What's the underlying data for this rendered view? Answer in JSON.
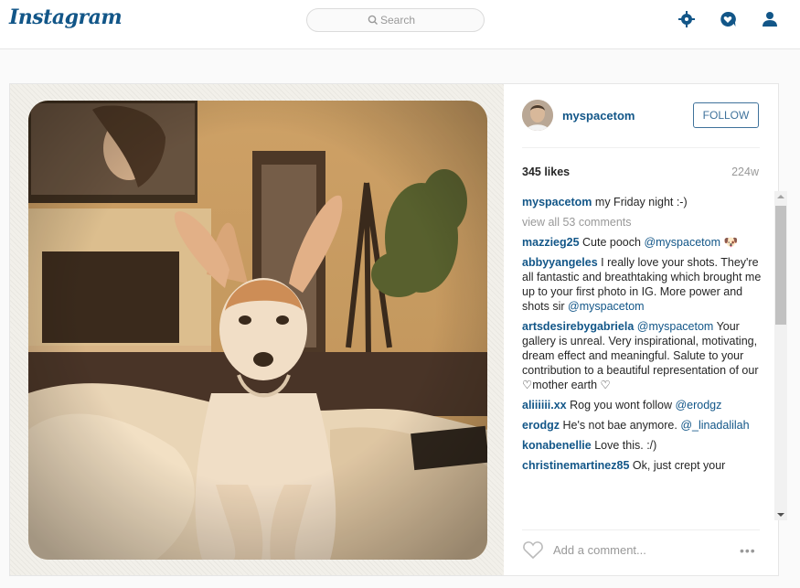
{
  "header": {
    "logo": "Instagram",
    "search_placeholder": "Search",
    "icons": [
      "search-icon",
      "explore-compass-icon",
      "activity-heart-icon",
      "profile-icon"
    ]
  },
  "post": {
    "username": "myspacetom",
    "follow_label": "FOLLOW",
    "likes": "345 likes",
    "time": "224w",
    "caption": {
      "user": "myspacetom",
      "text": "my Friday night :-)"
    },
    "view_all": "view all 53 comments",
    "comments": [
      {
        "user": "mazzieg25",
        "text": "Cute pooch ",
        "mention": "@myspacetom",
        "after": " 🐶"
      },
      {
        "user": "abbyyangeles",
        "text": "I really love your shots. They're all fantastic and breathtaking which brought me up to your first photo in IG. More power and shots sir ",
        "mention": "@myspacetom",
        "after": ""
      },
      {
        "user": "artsdesirebygabriela",
        "text": " ",
        "mention": "@myspacetom",
        "after": " Your gallery is unreal. Very inspirational, motivating, dream effect and meaningful. Salute to your contribution to a beautiful representation of our ♡mother earth ♡"
      },
      {
        "user": "aliiiiii.xx",
        "text": "Rog you wont follow ",
        "mention": "@erodgz",
        "after": ""
      },
      {
        "user": "erodgz",
        "text": "He's not bae anymore. ",
        "mention": "@_linadalilah",
        "after": ""
      },
      {
        "user": "konabenellie",
        "text": "Love this. :/)",
        "mention": "",
        "after": ""
      },
      {
        "user": "christinemartinez85",
        "text": "Ok, just crept your",
        "mention": "",
        "after": ""
      }
    ],
    "add_comment_placeholder": "Add a comment...",
    "more_label": "•••"
  },
  "colors": {
    "link": "#125688",
    "follow_border": "#3f729b",
    "muted": "#999999"
  }
}
